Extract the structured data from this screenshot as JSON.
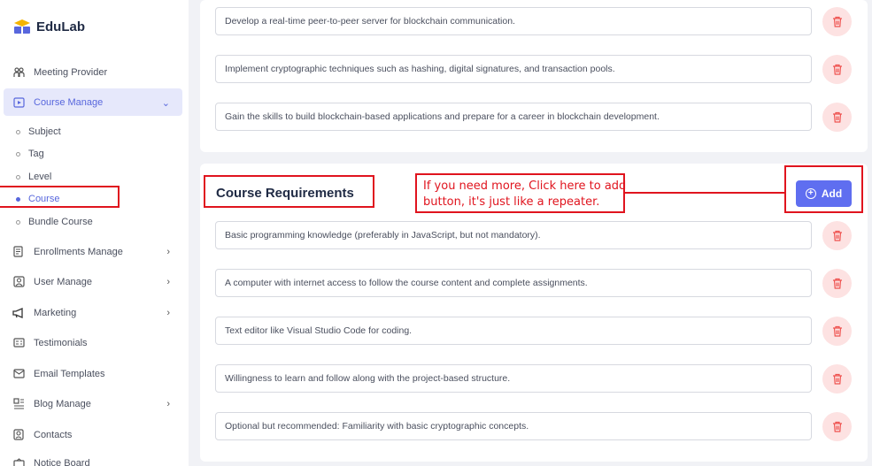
{
  "brand": {
    "name": "EduLab"
  },
  "sidebar": {
    "items_top": [
      {
        "label": "Meeting Provider",
        "icon": "meeting-icon"
      },
      {
        "label": "Course Manage",
        "icon": "course-manage-icon",
        "active": true
      }
    ],
    "course_sub": [
      {
        "label": "Subject"
      },
      {
        "label": "Tag"
      },
      {
        "label": "Level"
      },
      {
        "label": "Course",
        "active": true
      },
      {
        "label": "Bundle Course"
      }
    ],
    "items_bottom": [
      {
        "label": "Enrollments Manage",
        "icon": "enrollments-icon",
        "chevron": true
      },
      {
        "label": "User Manage",
        "icon": "user-icon",
        "chevron": true
      },
      {
        "label": "Marketing",
        "icon": "megaphone-icon",
        "chevron": true
      },
      {
        "label": "Testimonials",
        "icon": "testimonials-icon"
      },
      {
        "label": "Email Templates",
        "icon": "email-icon"
      },
      {
        "label": "Blog Manage",
        "icon": "blog-icon",
        "chevron": true
      },
      {
        "label": "Contacts",
        "icon": "contacts-icon"
      },
      {
        "label": "Notice Board",
        "icon": "notice-icon"
      }
    ]
  },
  "outcomes": {
    "items": [
      "Develop a real-time peer-to-peer server for blockchain communication.",
      "Implement cryptographic techniques such as hashing, digital signatures, and transaction pools.",
      "Gain the skills to build blockchain-based applications and prepare for a career in blockchain development."
    ]
  },
  "requirements": {
    "title": "Course Requirements",
    "add_label": "Add",
    "annotation": "If you need more, Click here to add button, it's just like a repeater.",
    "items": [
      "Basic programming knowledge (preferably in JavaScript, but not mandatory).",
      "A computer with internet access to follow the course content and complete assignments.",
      "Text editor like Visual Studio Code for coding.",
      "Willingness to learn and follow along with the project-based structure.",
      "Optional but recommended: Familiarity with basic cryptographic concepts."
    ]
  },
  "colors": {
    "accent": "#5f6ef0",
    "annotation": "#e0141e",
    "delete_bg": "#fde2e2",
    "delete_icon": "#ef5350"
  }
}
